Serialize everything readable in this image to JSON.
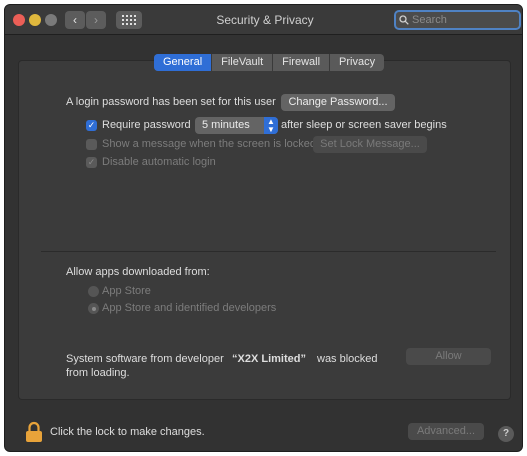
{
  "window": {
    "title": "Security & Privacy"
  },
  "search": {
    "placeholder": "Search"
  },
  "tabs": [
    {
      "label": "General",
      "active": true
    },
    {
      "label": "FileVault",
      "active": false
    },
    {
      "label": "Firewall",
      "active": false
    },
    {
      "label": "Privacy",
      "active": false
    }
  ],
  "general": {
    "login_password_text": "A login password has been set for this user",
    "change_password_label": "Change Password...",
    "require_password_label": "Require password",
    "require_password_checked": true,
    "require_password_delay": "5 minutes",
    "after_sleep_text": "after sleep or screen saver begins",
    "show_message_label": "Show a message when the screen is locked",
    "set_lock_message_label": "Set Lock Message...",
    "disable_auto_login_label": "Disable automatic login",
    "disable_auto_login_checked": true
  },
  "allow_apps": {
    "heading": "Allow apps downloaded from:",
    "options": [
      {
        "label": "App Store",
        "selected": false
      },
      {
        "label": "App Store and identified developers",
        "selected": true
      }
    ]
  },
  "blocked": {
    "line1_prefix": "System software from developer",
    "developer": "“X2X Limited”",
    "line1_suffix": "was blocked",
    "line2": "from loading.",
    "allow_label": "Allow"
  },
  "footer": {
    "lock_text": "Click the lock to make changes.",
    "advanced_label": "Advanced...",
    "help_label": "?"
  },
  "colors": {
    "accent": "#2f6ed6",
    "lock": "#e8a33a"
  }
}
